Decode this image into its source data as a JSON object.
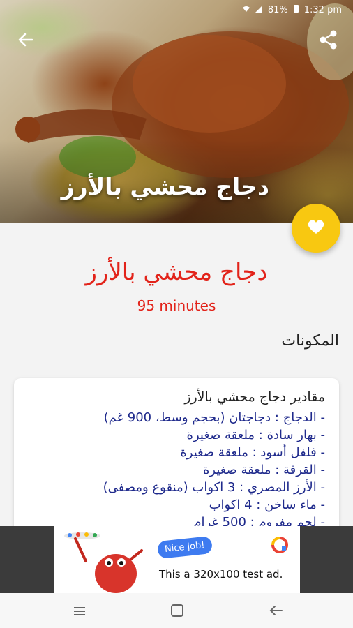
{
  "status": {
    "battery": "81%",
    "time": "1:32 pm"
  },
  "hero": {
    "title": "دجاج محشي بالأرز"
  },
  "recipe": {
    "title": "دجاج محشي بالأرز",
    "duration": "95 minutes",
    "ingredients_heading": "المكونات",
    "card_title": "مقادير دجاج محشي بالأرز",
    "items": [
      "- الدجاج : دجاجتان (بحجم وسط، 900 غم)",
      "- بهار سادة : ملعقة صغيرة",
      "- فلفل أسود : ملعقة صغيرة",
      "- القرفة : ملعقة صغيرة",
      "- الأرز المصري : 3 اكواب (منقوع ومصفى)",
      "- ماء ساخن : 4 اكواب",
      "- لحم مفروم : 500 غرام"
    ]
  },
  "ad": {
    "badge": "Nice job!",
    "message": "This a 320x100 test ad."
  },
  "colors": {
    "accent": "#e2231a",
    "fab": "#f8c811",
    "list_text": "#1f2a8c"
  },
  "icons": [
    "back-arrow-icon",
    "share-icon",
    "heart-icon",
    "recent-apps-icon",
    "home-icon",
    "back-nav-icon"
  ]
}
